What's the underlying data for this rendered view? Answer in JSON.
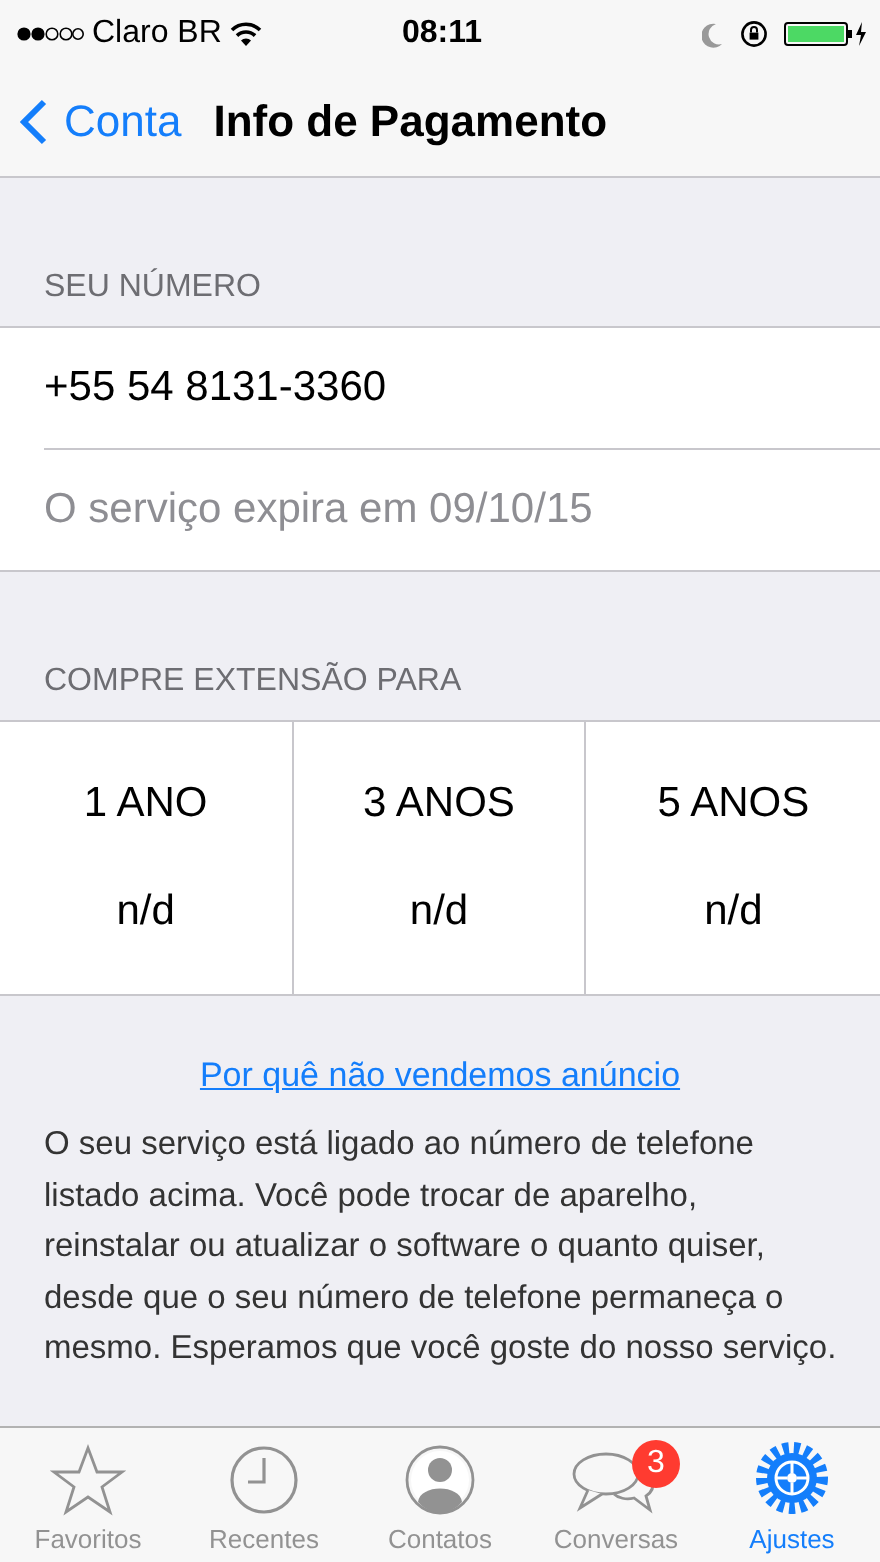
{
  "status_bar": {
    "carrier": "Claro BR",
    "time": "08:11"
  },
  "nav": {
    "back": "Conta",
    "title": "Info de Pagamento"
  },
  "number_section": {
    "header": "SEU NÚMERO",
    "number": "+55 54 8131-3360",
    "expiry": "O serviço expira em 09/10/15"
  },
  "extension_section": {
    "header": "COMPRE EXTENSÃO PARA",
    "options": [
      {
        "period": "1 ANO",
        "price": "n/d"
      },
      {
        "period": "3 ANOS",
        "price": "n/d"
      },
      {
        "period": "5 ANOS",
        "price": "n/d"
      }
    ]
  },
  "link": "Por quê não vendemos anúncio",
  "description": "O seu serviço está ligado ao número de telefone listado acima. Você pode trocar de aparelho, reinstalar ou atualizar o software o quanto quiser, desde que o seu número de telefone permaneça o mesmo. Esperamos que você goste do nosso serviço.",
  "tabs": [
    {
      "label": "Favoritos",
      "selected": false
    },
    {
      "label": "Recentes",
      "selected": false
    },
    {
      "label": "Contatos",
      "selected": false
    },
    {
      "label": "Conversas",
      "selected": false,
      "badge": "3"
    },
    {
      "label": "Ajustes",
      "selected": true
    }
  ]
}
